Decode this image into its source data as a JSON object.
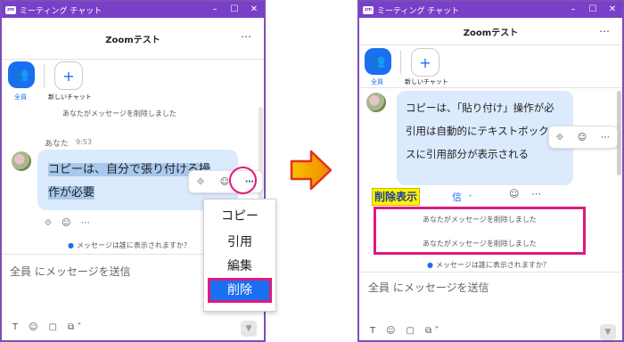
{
  "left_window": {
    "app_title": "ミーティング チャット",
    "chat_title": "Zoomテスト",
    "channels": [
      {
        "label": "全員",
        "icon": "group-icon"
      },
      {
        "label": "新しいチャット",
        "icon": "plus-icon"
      }
    ],
    "system_notice": "あなたがメッセージを削除しました",
    "sender": "あなた",
    "time": "9:53",
    "message_lines": [
      "コピーは、自分で張り付ける操",
      "作が必要"
    ],
    "context_menu": [
      "コピー",
      "引用",
      "編集",
      "削除"
    ],
    "selected_menu_item": "削除",
    "visibility_note": "メッセージは誰に表示されますか？",
    "composer_placeholder": "全員 にメッセージを送信"
  },
  "right_window": {
    "app_title": "ミーティング チャット",
    "chat_title": "Zoomテスト",
    "channels": [
      {
        "label": "全員",
        "icon": "group-icon"
      },
      {
        "label": "新しいチャット",
        "icon": "plus-icon"
      }
    ],
    "message_lines": [
      "コピーは、「貼り付け」操作が必",
      "引用は自動的にテキストボック",
      "スに引用部分が表示される"
    ],
    "annotation_label": "削除表示",
    "partial_link": "信",
    "deleted_notices": [
      "あなたがメッセージを削除しました",
      "あなたがメッセージを削除しました"
    ],
    "visibility_note": "メッセージは誰に表示されますか？",
    "composer_placeholder": "全員 にメッセージを送信"
  },
  "colors": {
    "title_bar": "#7a3fc7",
    "accent_blue": "#1a6ff0",
    "highlight_magenta": "#e0197d",
    "annotation_bg": "#fff200",
    "arrow_orange": "#f5a800",
    "arrow_red": "#e52f1f"
  }
}
